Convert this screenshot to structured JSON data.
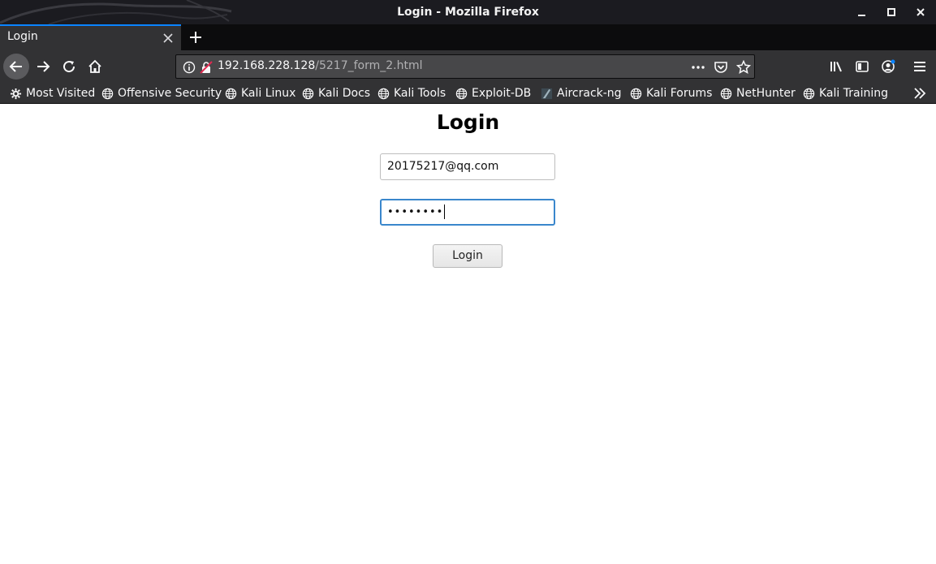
{
  "window": {
    "title": "Login - Mozilla Firefox"
  },
  "tabs": [
    {
      "label": "Login"
    }
  ],
  "urlbar": {
    "host": "192.168.228.128",
    "path": "/5217_form_2.html"
  },
  "bookmarks": [
    {
      "label": "Most Visited",
      "icon": "gear-icon"
    },
    {
      "label": "Offensive Security",
      "icon": "globe-icon"
    },
    {
      "label": "Kali Linux",
      "icon": "globe-icon"
    },
    {
      "label": "Kali Docs",
      "icon": "globe-icon"
    },
    {
      "label": "Kali Tools",
      "icon": "globe-icon"
    },
    {
      "label": "Exploit-DB",
      "icon": "globe-icon"
    },
    {
      "label": "Aircrack-ng",
      "icon": "aircrack-icon"
    },
    {
      "label": "Kali Forums",
      "icon": "globe-icon"
    },
    {
      "label": "NetHunter",
      "icon": "globe-icon"
    },
    {
      "label": "Kali Training",
      "icon": "globe-icon"
    }
  ],
  "page": {
    "heading": "Login",
    "email_value": "20175217@qq.com",
    "password_mask": "••••••••",
    "login_button": "Login"
  },
  "colors": {
    "titlebar": "#1b1b20",
    "toolbar": "#323234",
    "tab_accent": "#0a84ff",
    "focus_ring": "#3a87cc"
  }
}
